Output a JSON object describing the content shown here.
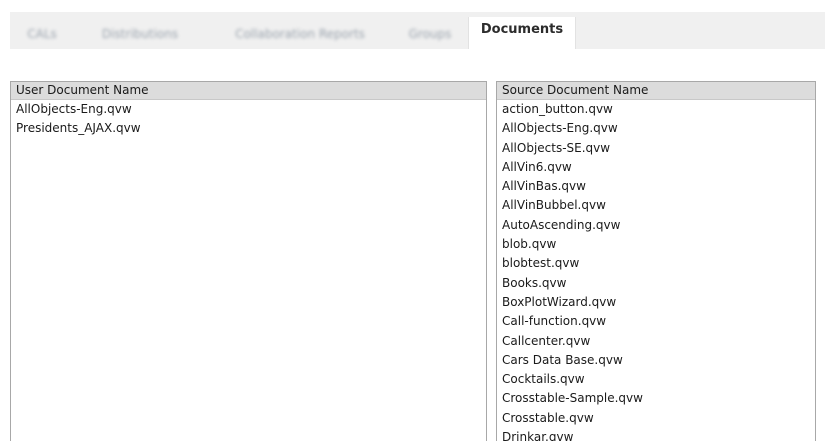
{
  "tabs": [
    {
      "label": "CALs"
    },
    {
      "label": "Distributions"
    },
    {
      "label": "Collaboration Reports"
    },
    {
      "label": "Groups"
    },
    {
      "label": "Documents"
    }
  ],
  "user_documents": {
    "header": "User Document Name",
    "items": [
      "AllObjects-Eng.qvw",
      "Presidents_AJAX.qvw"
    ]
  },
  "source_documents": {
    "header": "Source Document Name",
    "items": [
      "action_button.qvw",
      "AllObjects-Eng.qvw",
      "AllObjects-SE.qvw",
      "AllVin6.qvw",
      "AllVinBas.qvw",
      "AllVinBubbel.qvw",
      "AutoAscending.qvw",
      "blob.qvw",
      "blobtest.qvw",
      "Books.qvw",
      "BoxPlotWizard.qvw",
      "Call-function.qvw",
      "Callcenter.qvw",
      "Cars Data Base.qvw",
      "Cocktails.qvw",
      "Crosstable-Sample.qvw",
      "Crosstable.qvw",
      "Drinkar.qvw"
    ]
  }
}
